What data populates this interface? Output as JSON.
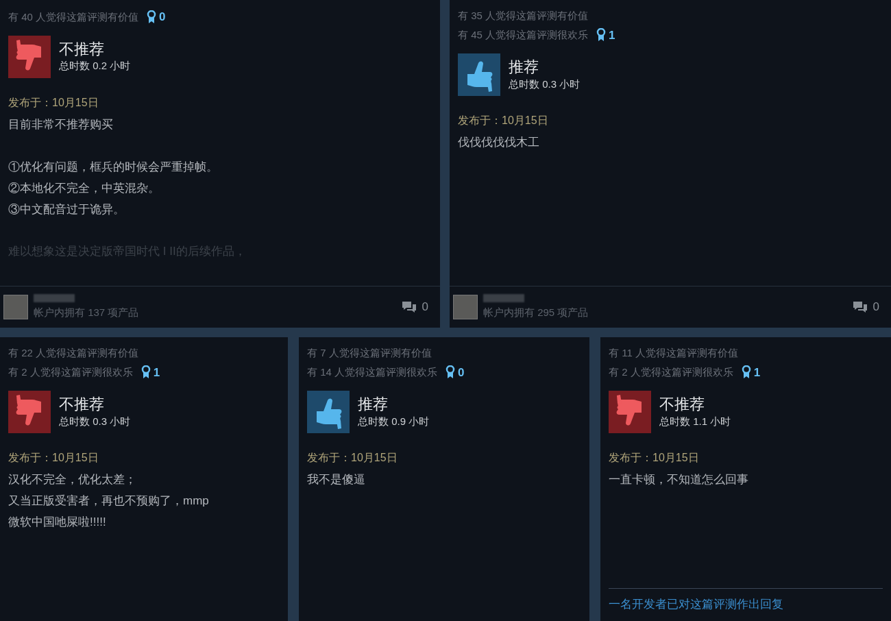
{
  "top_reviews": [
    {
      "helpful_lines": [
        "有 40 人觉得这篇评测有价值"
      ],
      "awards": "0",
      "recommended": false,
      "title": "不推荐",
      "hours": "总时数 0.2 小时",
      "posted": "发布于：10月15日",
      "body": [
        "目前非常不推荐购买"
      ],
      "points": [
        "①优化有问题，框兵的时候会严重掉帧。",
        "②本地化不完全，中英混杂。",
        "③中文配音过于诡异。"
      ],
      "faded_line": "难以想象这是决定版帝国时代 I II的后续作品，",
      "owner": {
        "products": "帐户内拥有 137 项产品",
        "comments": "0"
      }
    },
    {
      "helpful_lines": [
        "有 35 人觉得这篇评测有价值",
        "有 45 人觉得这篇评测很欢乐"
      ],
      "awards": "1",
      "recommended": true,
      "title": "推荐",
      "hours": "总时数 0.3 小时",
      "posted": "发布于：10月15日",
      "body": [
        "伐伐伐伐伐木工"
      ],
      "owner": {
        "products": "帐户内拥有 295 项产品",
        "comments": "0"
      }
    }
  ],
  "bottom_reviews": [
    {
      "helpful_lines": [
        "有 22 人觉得这篇评测有价值",
        "有 2 人觉得这篇评测很欢乐"
      ],
      "awards": "1",
      "recommended": false,
      "title": "不推荐",
      "hours": "总时数 0.3 小时",
      "posted": "发布于：10月15日",
      "body": [
        "汉化不完全，优化太差；",
        "又当正版受害者，再也不预购了，mmp",
        "微软中国吔屎啦!!!!!"
      ]
    },
    {
      "helpful_lines": [
        "有 7 人觉得这篇评测有价值",
        "有 14 人觉得这篇评测很欢乐"
      ],
      "awards": "0",
      "recommended": true,
      "title": "推荐",
      "hours": "总时数 0.9 小时",
      "posted": "发布于：10月15日",
      "body": [
        "我不是傻逼"
      ]
    },
    {
      "helpful_lines": [
        "有 11 人觉得这篇评测有价值",
        "有 2 人觉得这篇评测很欢乐"
      ],
      "awards": "1",
      "recommended": false,
      "title": "不推荐",
      "hours": "总时数 1.1 小时",
      "posted": "发布于：10月15日",
      "body": [
        "一直卡顿，不知道怎么回事"
      ],
      "developer_reply": "一名开发者已对这篇评测作出回复"
    }
  ]
}
